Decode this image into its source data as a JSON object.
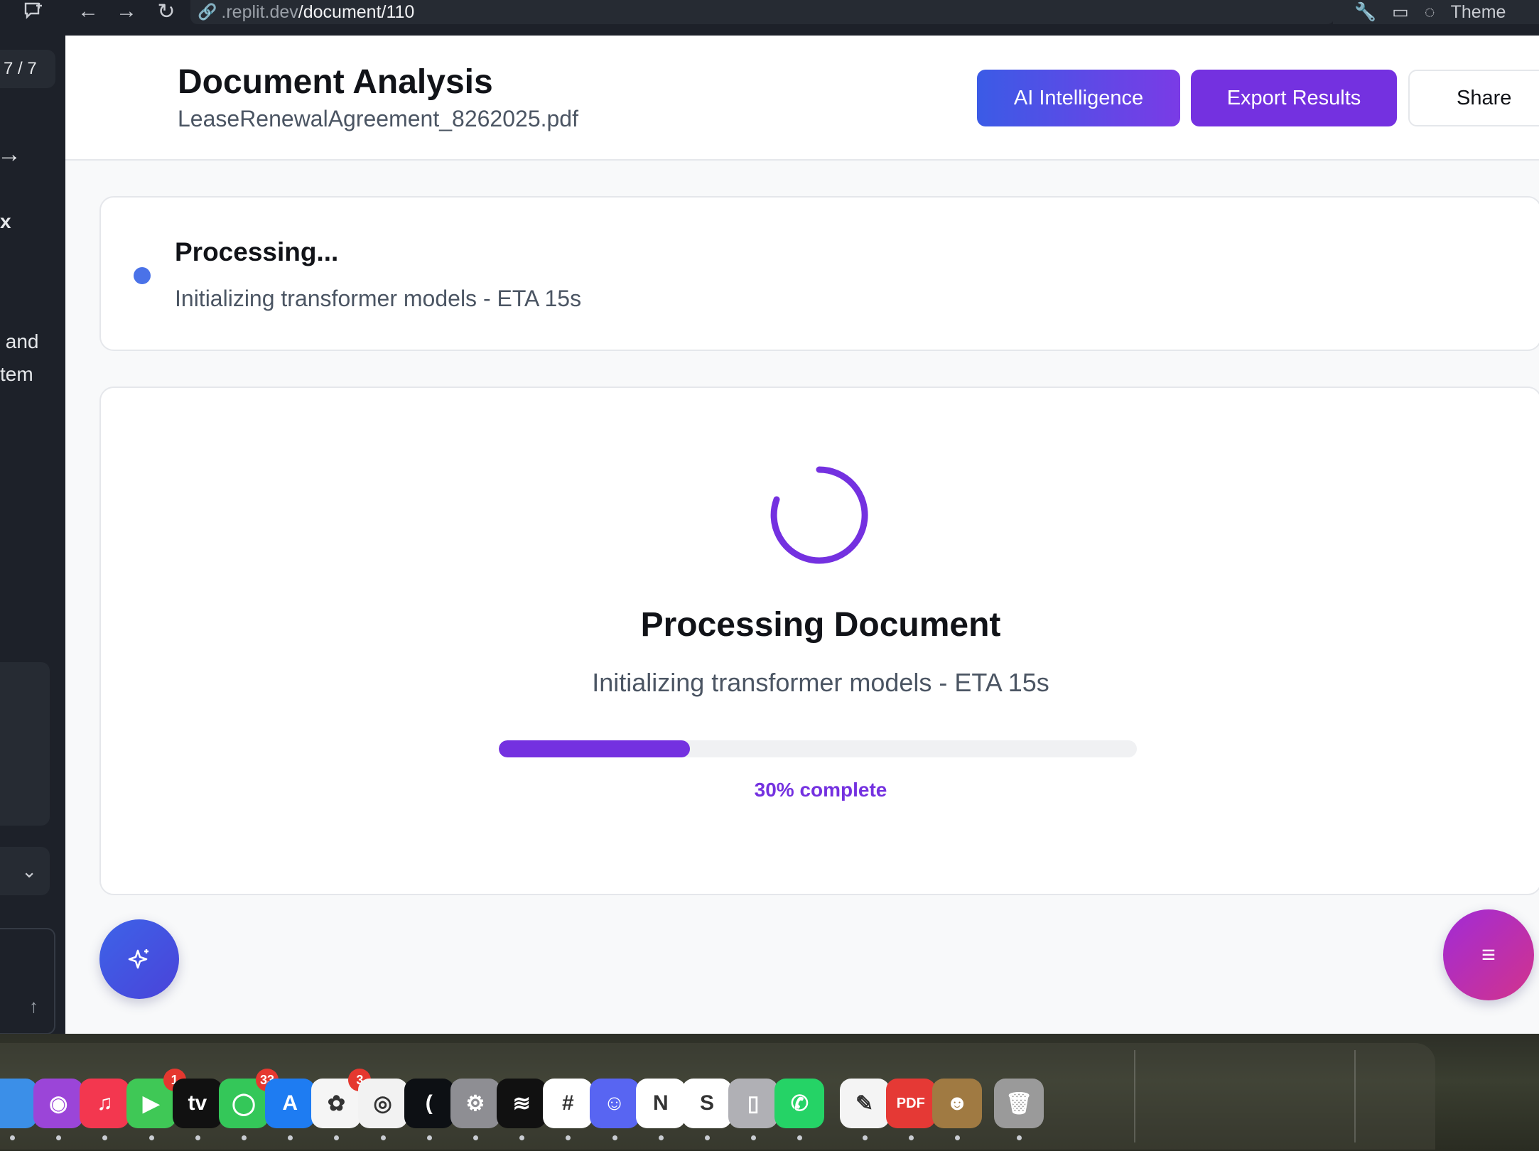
{
  "browser": {
    "url_prefix": ".replit.dev",
    "url_path": "/document/110",
    "theme_label": "Theme"
  },
  "sidebar": {
    "page_counter": "7 / 7",
    "arrow": "→",
    "close": "x",
    "text": " and\ntem"
  },
  "header": {
    "title": "Document Analysis",
    "filename": "LeaseRenewalAgreement_8262025.pdf",
    "ai_button": "AI Intelligence",
    "export_button": "Export Results",
    "share_button": "Share"
  },
  "status": {
    "title": "Processing...",
    "subtitle": "Initializing transformer models - ETA 15s",
    "dot_color": "#4a72e8"
  },
  "processing": {
    "title": "Processing Document",
    "subtitle": "Initializing transformer models - ETA 15s",
    "progress_fraction": 0.3,
    "progress_label": "30% complete",
    "accent_color": "#7431e0"
  },
  "fabs": {
    "ai_icon": "sparkles-icon",
    "menu_icon": "menu-icon",
    "menu_glyph": "≡"
  },
  "dock": {
    "icons": [
      {
        "name": "finder-icon",
        "color": "#3b8fe8",
        "glyph": ""
      },
      {
        "name": "podcasts-icon",
        "color": "#9b45d8",
        "glyph": "◉"
      },
      {
        "name": "music-icon",
        "color": "#f3374f",
        "glyph": "♫"
      },
      {
        "name": "facetime-icon",
        "color": "#3fc856",
        "glyph": "▶",
        "badge": "1"
      },
      {
        "name": "appletv-icon",
        "color": "#111111",
        "glyph": "tv"
      },
      {
        "name": "messages-icon",
        "color": "#34c759",
        "glyph": "◯",
        "badge": "33"
      },
      {
        "name": "appstore-icon",
        "color": "#1e7cf2",
        "glyph": "A"
      },
      {
        "name": "photos-icon",
        "color": "#f5f5f5",
        "glyph": "✿",
        "badge": "3"
      },
      {
        "name": "chrome-icon",
        "color": "#f2f2f2",
        "glyph": "◎"
      },
      {
        "name": "cursor-icon",
        "color": "#0d1014",
        "glyph": "("
      },
      {
        "name": "settings-icon",
        "color": "#8e8e93",
        "glyph": "⚙"
      },
      {
        "name": "spotify-icon",
        "color": "#111111",
        "glyph": "≋"
      },
      {
        "name": "slack-icon",
        "color": "#ffffff",
        "glyph": "#"
      },
      {
        "name": "discord-icon",
        "color": "#5865f2",
        "glyph": "☺"
      },
      {
        "name": "news-icon",
        "color": "#ffffff",
        "glyph": "N"
      },
      {
        "name": "skype-icon",
        "color": "#ffffff",
        "glyph": "S"
      },
      {
        "name": "iphone-mirroring-icon",
        "color": "#b0b0b5",
        "glyph": "▯"
      },
      {
        "name": "whatsapp-icon",
        "color": "#25d366",
        "glyph": "✆"
      },
      {
        "name": "textedit-icon",
        "color": "#f4f4f4",
        "glyph": "✎"
      },
      {
        "name": "pdf-expert-icon",
        "color": "#e53935",
        "glyph": "PDF"
      },
      {
        "name": "contacts-icon",
        "color": "#a07a42",
        "glyph": "☻"
      },
      {
        "name": "trash-icon",
        "color": "#9a9a9a",
        "glyph": "🗑"
      }
    ]
  }
}
